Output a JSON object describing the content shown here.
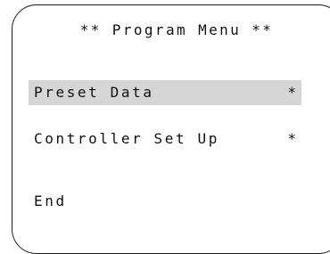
{
  "menu": {
    "title": "** Program Menu **",
    "items": [
      {
        "label": "Preset Data",
        "marker": "*",
        "selected": true
      },
      {
        "label": "Controller Set Up",
        "marker": "*",
        "selected": false
      },
      {
        "label": "End",
        "marker": "",
        "selected": false
      }
    ]
  },
  "colors": {
    "selection_highlight": "#d6d6d6",
    "frame": "#1a1a1a",
    "text": "#111111"
  }
}
